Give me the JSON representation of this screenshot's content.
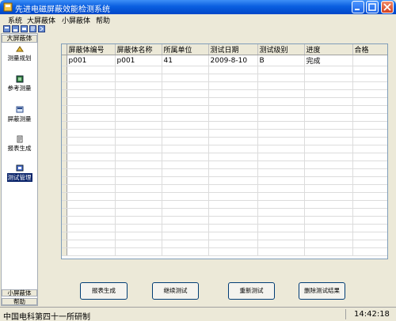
{
  "window": {
    "title": "先进电磁屏蔽效能检测系统",
    "icon": "app-icon"
  },
  "menu": {
    "items": [
      "系统",
      "大屏蔽体",
      "小屏蔽体",
      "帮助"
    ]
  },
  "toolbar": {
    "icons": [
      "tool-open-icon",
      "tool-save-icon",
      "tool-print-icon",
      "tool-report-icon",
      "tool-exit-icon"
    ]
  },
  "sidebar": {
    "header": "大屏蔽体",
    "items": [
      {
        "label": "测量规划",
        "icon": "plan-icon",
        "selected": false
      },
      {
        "label": "参考测量",
        "icon": "reference-icon",
        "selected": false
      },
      {
        "label": "屏蔽测量",
        "icon": "shield-measure-icon",
        "selected": false
      },
      {
        "label": "报表生成",
        "icon": "report-icon",
        "selected": false
      },
      {
        "label": "测试管理",
        "icon": "test-manage-icon",
        "selected": true
      }
    ],
    "footer_items": [
      "小屏蔽体",
      "帮助"
    ]
  },
  "grid": {
    "columns": [
      "屏蔽体编号",
      "屏蔽体名称",
      "所属单位",
      "测试日期",
      "测试级别",
      "进度",
      "合格"
    ],
    "rows": [
      [
        "p001",
        "p001",
        "41",
        "2009-8-10",
        "B",
        "完成",
        ""
      ]
    ],
    "empty_rows": 24
  },
  "buttons": {
    "report": "报表生成",
    "continue": "继续测试",
    "retest": "重新测试",
    "delete": "删除测试结果"
  },
  "status": {
    "left": "中国电科第四十一所研制",
    "time": "14:42:18"
  },
  "colors": {
    "titlebar": "#0a5fe0",
    "selection": "#0a246a",
    "face": "#ece9d8"
  }
}
